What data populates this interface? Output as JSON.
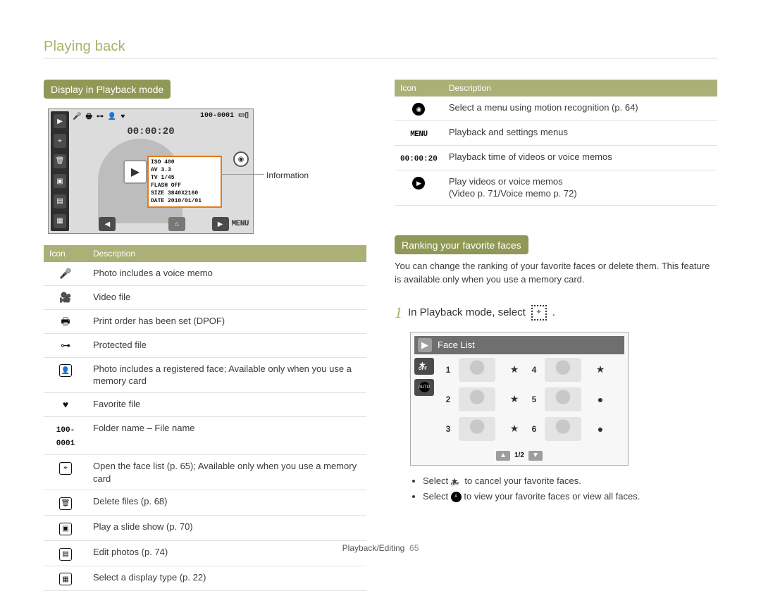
{
  "page": {
    "title": "Playing back",
    "footer_section": "Playback/Editing",
    "footer_page": "65"
  },
  "left": {
    "heading": "Display in Playback mode",
    "info_label": "Information",
    "screen": {
      "folder": "100-0001",
      "battery_icon": "battery-icon",
      "time": "00:00:20",
      "info_lines": {
        "iso": "ISO 400",
        "av": "AV 3.3",
        "tv": "TV 1/45",
        "flash": "FLASH OFF",
        "size": "SIZE 3840X2160",
        "date": "DATE 2010/01/01"
      },
      "menu_label": "MENU"
    },
    "table_headers": {
      "icon": "Icon",
      "desc": "Description"
    },
    "rows": [
      {
        "icon_name": "mic-icon",
        "glyph": "🎤",
        "desc": "Photo includes a voice memo"
      },
      {
        "icon_name": "video-icon",
        "glyph": "🎥",
        "desc": "Video file"
      },
      {
        "icon_name": "print-icon",
        "glyph": "🖶",
        "desc": "Print order has been set (DPOF)"
      },
      {
        "icon_name": "lock-icon",
        "glyph": "⊶",
        "desc": "Protected file"
      },
      {
        "icon_name": "face-reg-icon",
        "glyph": "👤",
        "desc": "Photo includes a registered face; Available only when you use a memory card"
      },
      {
        "icon_name": "heart-icon",
        "glyph": "♥",
        "desc": "Favorite file"
      },
      {
        "icon_name": "folder-file-icon",
        "glyph": "100-0001",
        "desc": "Folder name – File name"
      },
      {
        "icon_name": "face-list-icon",
        "glyph": "⌖",
        "desc": "Open the face list (p. 65); Available only when you use a memory card"
      },
      {
        "icon_name": "trash-icon",
        "glyph": "🗑",
        "desc": "Delete files (p. 68)"
      },
      {
        "icon_name": "slideshow-icon",
        "glyph": "▣",
        "desc": "Play a slide show (p. 70)"
      },
      {
        "icon_name": "edit-icon",
        "glyph": "▤",
        "desc": "Edit photos (p. 74)"
      },
      {
        "icon_name": "display-type-icon",
        "glyph": "▦",
        "desc": "Select a display type (p. 22)"
      }
    ]
  },
  "right_top": {
    "table_headers": {
      "icon": "Icon",
      "desc": "Description"
    },
    "rows": [
      {
        "icon_name": "motion-icon",
        "glyph": "◉",
        "desc": "Select a menu using motion recognition (p. 64)"
      },
      {
        "icon_name": "menu-text-icon",
        "glyph": "MENU",
        "desc": "Playback and settings menus"
      },
      {
        "icon_name": "time-text-icon",
        "glyph": "00:00:20",
        "desc": "Playback time of videos or voice memos"
      },
      {
        "icon_name": "play-circle-icon",
        "glyph": "▶",
        "desc_l1": "Play videos or voice memos",
        "desc_l2": "(Video p. 71/Voice memo p. 72)"
      }
    ]
  },
  "ranking": {
    "heading": "Ranking your favorite faces",
    "body": "You can change the ranking of your favorite faces or delete them. This feature is available only when you use a memory card.",
    "step1_prefix": "In Playback mode, select",
    "step1_suffix": ".",
    "face_title": "Face List",
    "face_nums": [
      "1",
      "2",
      "3",
      "4",
      "5",
      "6"
    ],
    "face_stars": [
      "★",
      "★",
      "★",
      "★",
      "●",
      "●"
    ],
    "pager": "1/2",
    "bullet1_a": "Select ",
    "bullet1_b": " to cancel your favorite faces.",
    "bullet2_a": "Select ",
    "bullet2_b": " to view your favorite faces or view all faces."
  }
}
